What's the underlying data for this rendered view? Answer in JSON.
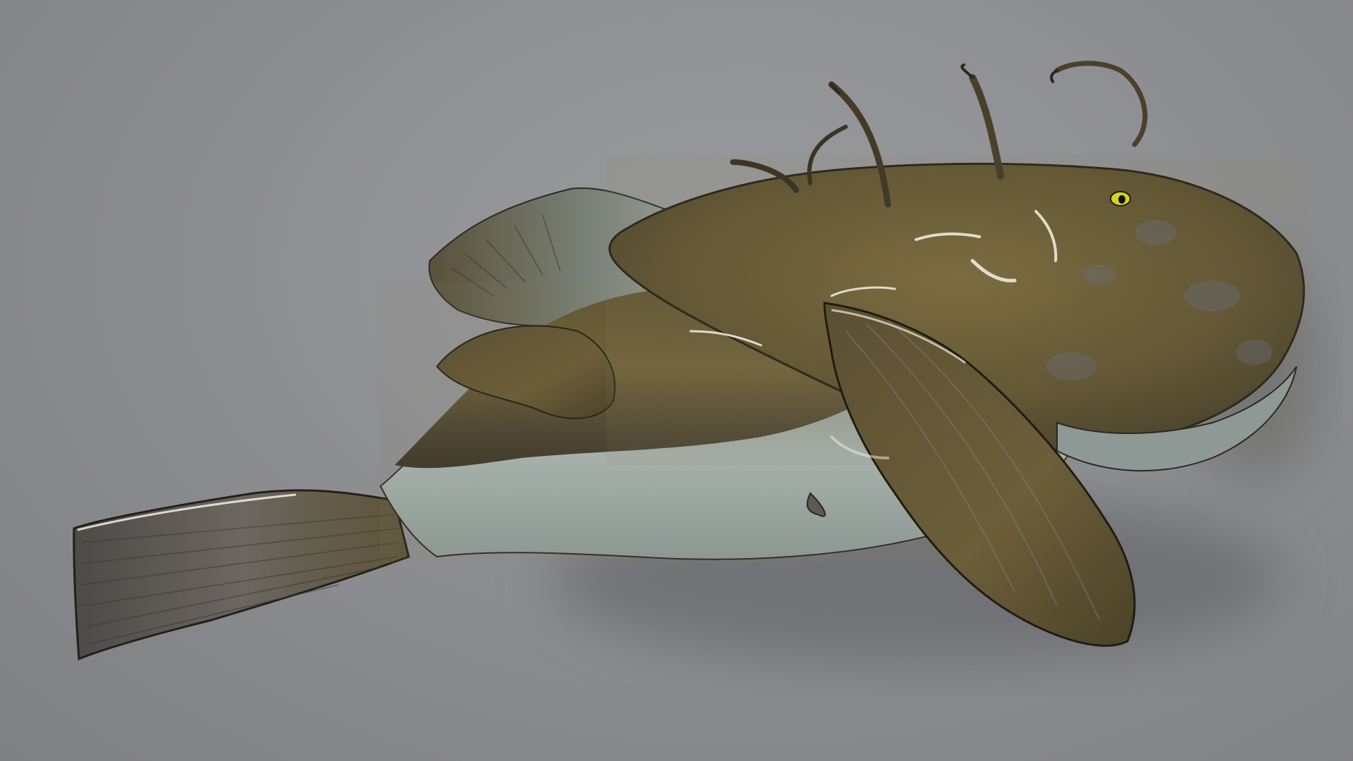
{
  "scene": {
    "subject": "anglerfish-render",
    "colors": {
      "background": "#8e8f92",
      "body_dark": "#3a3422",
      "body_mid": "#6a5a32",
      "body_light": "#8a7846",
      "belly": "#b8c4c4",
      "eye": "#d8d820",
      "highlight": "#f2f0e6"
    }
  }
}
